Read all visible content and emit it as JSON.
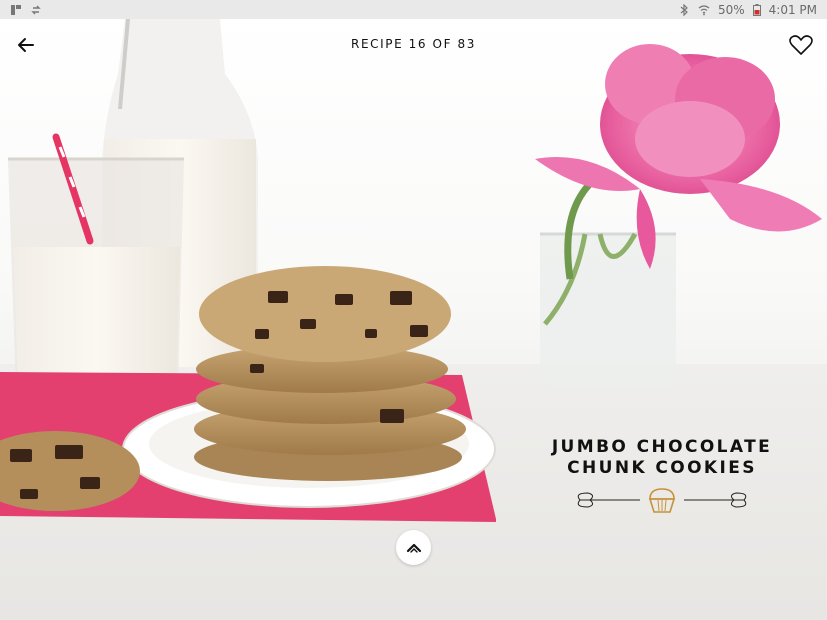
{
  "status_bar": {
    "battery": "50%",
    "time": "4:01 PM"
  },
  "header": {
    "counter": "RECIPE 16 OF 83"
  },
  "recipe": {
    "title_lines": [
      "JUMBO CHOCOLATE",
      "CHUNK COOKIES"
    ]
  },
  "icons": {
    "back": "arrow-left-icon",
    "favorite": "heart-outline-icon",
    "scroll_up": "chevron-up-icon",
    "category": "cupcake-icon"
  },
  "colors": {
    "accent_gold": "#c8923a",
    "napkin_pink": "#e3406f",
    "text_dark": "#111111"
  }
}
